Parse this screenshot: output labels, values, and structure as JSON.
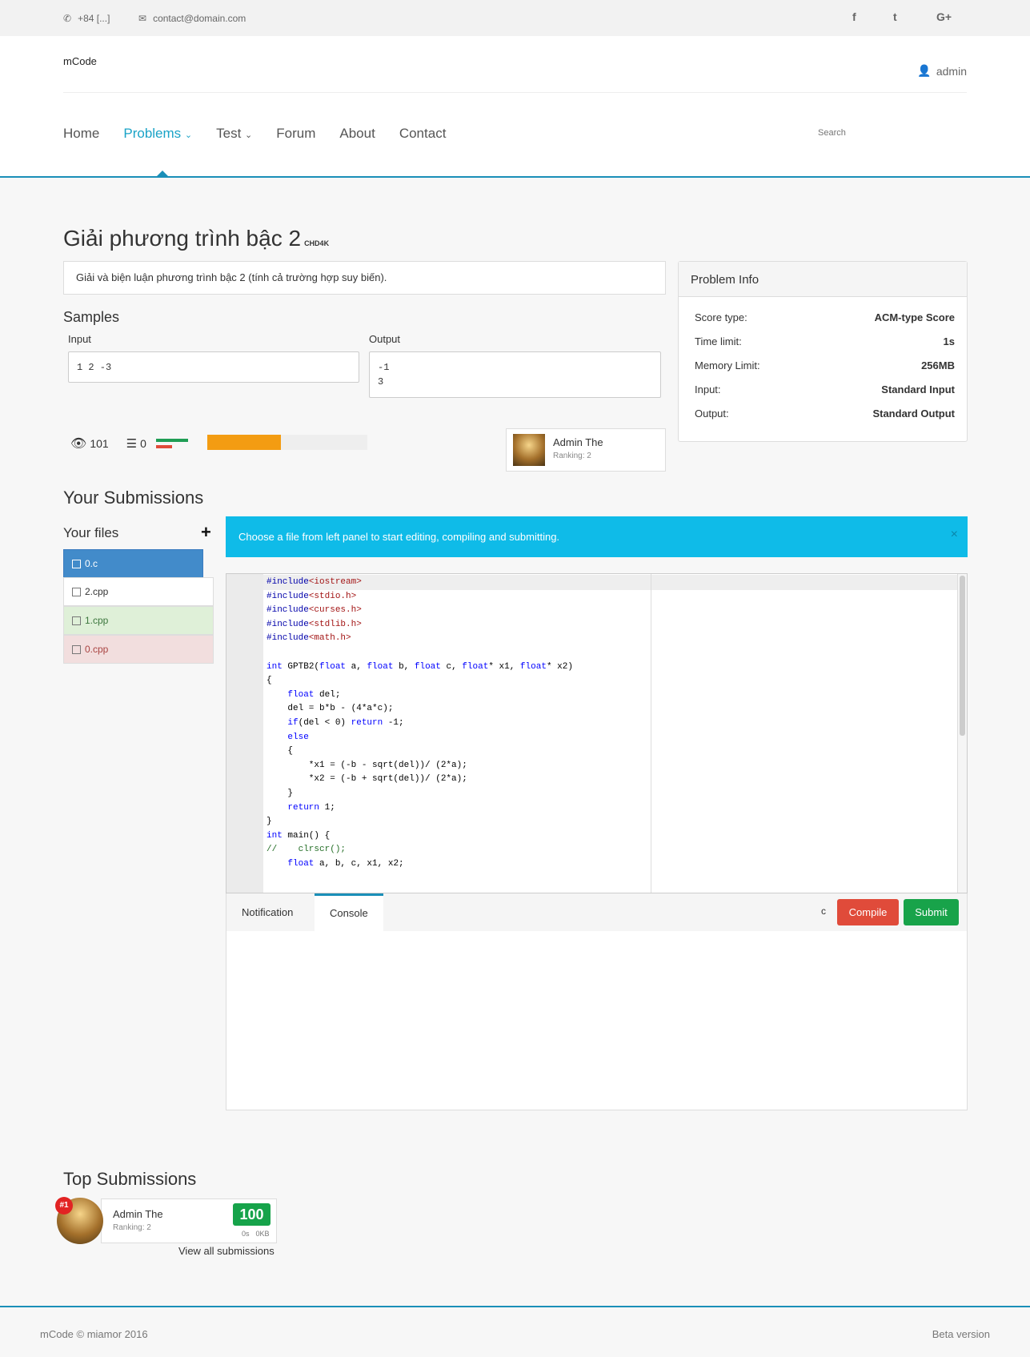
{
  "topbar": {
    "phone": "+84 [...]",
    "email": "contact@domain.com",
    "social": [
      "f",
      "t",
      "G+"
    ]
  },
  "header": {
    "logo": "mCode",
    "user": "admin",
    "nav": [
      "Home",
      "Problems",
      "Test",
      "Forum",
      "About",
      "Contact"
    ],
    "search_placeholder": "Search"
  },
  "problem": {
    "title": "Giải phương trình bậc 2",
    "code": "CHD4K",
    "description": "Giải và biện luận phương trình bậc 2 (tính cả trường hợp suy biến).",
    "samples_heading": "Samples",
    "input_label": "Input",
    "output_label": "Output",
    "sample_input": "1 2 -3",
    "sample_output": "-1\n3",
    "views": "101",
    "submissions_count": "0",
    "progress_fraction": 0.46,
    "author_name": "Admin The",
    "author_ranking": "Ranking: 2"
  },
  "problem_info": {
    "heading": "Problem Info",
    "rows": [
      {
        "label": "Score type:",
        "value": "ACM-type Score"
      },
      {
        "label": "Time limit:",
        "value": "1s"
      },
      {
        "label": "Memory Limit:",
        "value": "256MB"
      },
      {
        "label": "Input:",
        "value": "Standard Input"
      },
      {
        "label": "Output:",
        "value": "Standard Output"
      }
    ]
  },
  "submissions": {
    "heading": "Your Submissions",
    "files_heading": "Your files",
    "files": [
      "0.c",
      "2.cpp",
      "1.cpp",
      "0.cpp"
    ],
    "alert": "Choose a file from left panel to start editing, compiling and submitting.",
    "alert_close": "×"
  },
  "editor": {
    "lines": [
      "#include<iostream>",
      "#include<stdio.h>",
      "#include<curses.h>",
      "#include<stdlib.h>",
      "#include<math.h>",
      "",
      "int GPTB2(float a, float b, float c, float* x1, float* x2)",
      "{",
      "    float del;",
      "    del = b*b - (4*a*c);",
      "    if(del < 0) return -1;",
      "    else",
      "    {",
      "        *x1 = (-b - sqrt(del))/ (2*a);",
      "        *x2 = (-b + sqrt(del))/ (2*a);",
      "    }",
      "    return 1;",
      "}",
      "int main() {",
      "//    clrscr();",
      "    float a, b, c, x1, x2;"
    ],
    "fold_lines": [
      8,
      13,
      19
    ]
  },
  "console": {
    "tab_notification": "Notification",
    "tab_console": "Console",
    "language": "c",
    "compile": "Compile",
    "submit": "Submit"
  },
  "top_submissions": {
    "heading": "Top Submissions",
    "rank_badge": "#1",
    "name": "Admin The",
    "ranking": "Ranking: 2",
    "score": "100",
    "time": "0s",
    "memory": "0KB",
    "view_all": "View all submissions"
  },
  "footer": {
    "left": "mCode © miamor 2016",
    "right": "Beta version"
  },
  "colors": {
    "accent": "#1a8fb8",
    "alert": "#0fbbe8",
    "compile": "#e04b3a",
    "submit": "#18a34a",
    "progress": "#f39c12"
  }
}
